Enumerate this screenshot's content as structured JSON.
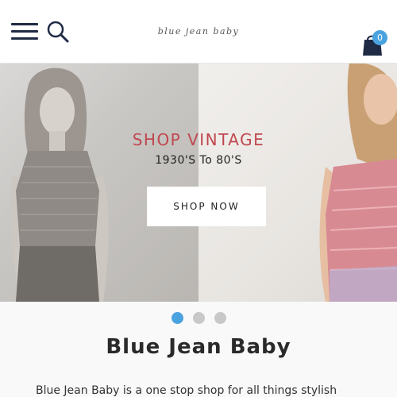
{
  "header": {
    "menu_icon": "hamburger-menu-icon",
    "search_icon": "search-icon",
    "logo_text": "blue jean baby",
    "cart_icon": "shopping-bag-icon",
    "cart_count": "0"
  },
  "hero": {
    "title": "SHOP VINTAGE",
    "subtitle": "1930'S To 80'S",
    "button_label": "SHOP NOW"
  },
  "slider": {
    "dot_count": 3,
    "active_index": 0
  },
  "content": {
    "heading": "Blue Jean Baby",
    "intro": "Blue Jean Baby is a one stop shop for all things stylish"
  },
  "colors": {
    "accent": "#4aa3df",
    "title_red": "#c0474f",
    "navy": "#1f2a44"
  }
}
